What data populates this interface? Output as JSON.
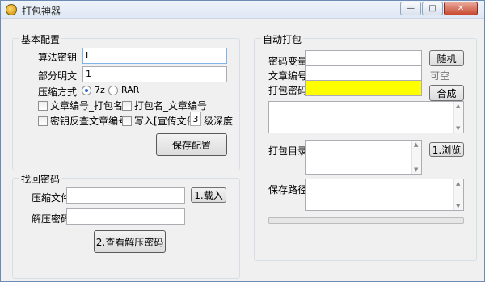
{
  "window": {
    "title": "打包神器",
    "minimize": "—",
    "maximize": "□",
    "close": "✕"
  },
  "basic": {
    "title": "基本配置",
    "algo_key_label": "算法密钥",
    "algo_key_value": "I",
    "part_plain_label": "部分明文",
    "part_plain_value": "1",
    "compress_label": "压缩方式",
    "opt_7z": "7z",
    "opt_rar": "RAR",
    "chk1": "文章编号_打包名",
    "chk2": "打包名_文章编号",
    "chk3": "密钥反查文章编号",
    "chk4": "写入[宣传文件]",
    "depth_value": "3",
    "depth_label": "级深度",
    "save_btn": "保存配置"
  },
  "recover": {
    "title": "找回密码",
    "file_label": "压缩文件",
    "load_btn": "1.载入",
    "pwd_label": "解压密码",
    "view_btn": "2.查看解压密码"
  },
  "auto": {
    "title": "自动打包",
    "pwd_var_label": "密码变量",
    "random_btn": "随机",
    "article_no_label": "文章编号",
    "optional_hint": "可空",
    "pack_pwd_label": "打包密码",
    "combine_btn": "合成",
    "pack_dir_label": "打包目录",
    "browse_btn": "1.浏览",
    "save_path_label": "保存路径"
  }
}
